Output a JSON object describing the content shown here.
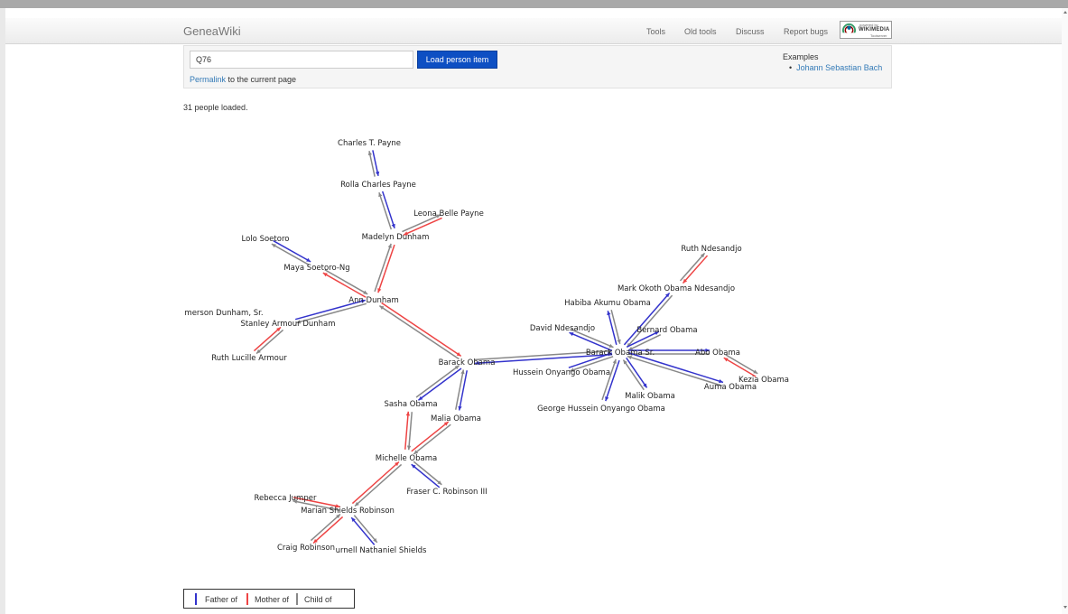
{
  "navbar": {
    "brand": "GeneaWiki",
    "links": [
      "Tools",
      "Old tools",
      "Discuss",
      "Report bugs"
    ],
    "badge": {
      "line1": "powered by",
      "line2": "WIKIMEDIA",
      "line3": "Toolserver"
    }
  },
  "search": {
    "value": "Q76",
    "button_label": "Load person item",
    "permalink_label": "Permalink",
    "permalink_suffix": " to the current page"
  },
  "examples": {
    "title": "Examples",
    "items": [
      "Johann Sebastian Bach"
    ]
  },
  "status": "31 people loaded.",
  "colors": {
    "father": "#3333cc",
    "mother": "#ee4444",
    "child": "#888888",
    "button": "#0d4fc3",
    "link": "#337ab7"
  },
  "graph": {
    "nodes": [
      {
        "id": "charles_payne",
        "label": "Charles T. Payne"
      },
      {
        "id": "rolla_payne",
        "label": "Rolla Charles Payne"
      },
      {
        "id": "leona_payne",
        "label": "Leona Belle Payne"
      },
      {
        "id": "madelyn_dunham",
        "label": "Madelyn Dunham"
      },
      {
        "id": "lolo_soetoro",
        "label": "Lolo Soetoro"
      },
      {
        "id": "maya_soetoro",
        "label": "Maya Soetoro-Ng"
      },
      {
        "id": "ann_dunham",
        "label": "Ann Dunham"
      },
      {
        "id": "emerson_dunham",
        "label": "merson Dunham, Sr."
      },
      {
        "id": "stanley_dunham",
        "label": "Stanley Armour Dunham"
      },
      {
        "id": "ruth_armour",
        "label": "Ruth Lucille Armour"
      },
      {
        "id": "barack_obama",
        "label": "Barack Obama"
      },
      {
        "id": "sasha_obama",
        "label": "Sasha Obama"
      },
      {
        "id": "malia_obama",
        "label": "Malia Obama"
      },
      {
        "id": "michelle_obama",
        "label": "Michelle Obama"
      },
      {
        "id": "fraser_robinson",
        "label": "Fraser C. Robinson III"
      },
      {
        "id": "rebecca_jumper",
        "label": "Rebecca Jumper"
      },
      {
        "id": "marian_robinson",
        "label": "Marian Shields Robinson"
      },
      {
        "id": "craig_robinson",
        "label": "Craig Robinson"
      },
      {
        "id": "purnell_shields",
        "label": "urnell Nathaniel Shields"
      },
      {
        "id": "ruth_ndesandjo",
        "label": "Ruth Ndesandjo"
      },
      {
        "id": "mark_ndesandjo",
        "label": "Mark Okoth Obama Ndesandjo"
      },
      {
        "id": "habiba_obama",
        "label": "Habiba Akumu Obama"
      },
      {
        "id": "bernard_obama",
        "label": "Bernard Obama"
      },
      {
        "id": "david_ndesandjo",
        "label": "David Ndesandjo"
      },
      {
        "id": "barack_sr",
        "label": "Barack Obama Sr."
      },
      {
        "id": "abo_obama",
        "label": "Abo Obama"
      },
      {
        "id": "hussein_onyango",
        "label": "Hussein Onyango Obama"
      },
      {
        "id": "kezia_obama",
        "label": "Kezia Obama"
      },
      {
        "id": "auma_obama",
        "label": "Auma Obama"
      },
      {
        "id": "malik_obama",
        "label": "Malik Obama"
      },
      {
        "id": "george_obama",
        "label": "George Hussein Onyango Obama"
      }
    ],
    "edges": [
      {
        "from": "rolla_payne",
        "to": "charles_payne",
        "rel": "father"
      },
      {
        "from": "madelyn_dunham",
        "to": "rolla_payne",
        "rel": "father"
      },
      {
        "from": "madelyn_dunham",
        "to": "leona_payne",
        "rel": "mother"
      },
      {
        "from": "ann_dunham",
        "to": "madelyn_dunham",
        "rel": "mother"
      },
      {
        "from": "maya_soetoro",
        "to": "lolo_soetoro",
        "rel": "father"
      },
      {
        "from": "maya_soetoro",
        "to": "ann_dunham",
        "rel": "mother"
      },
      {
        "from": "ann_dunham",
        "to": "stanley_dunham",
        "rel": "father"
      },
      {
        "from": "stanley_dunham",
        "to": "ruth_armour",
        "rel": "mother"
      },
      {
        "from": "barack_obama",
        "to": "ann_dunham",
        "rel": "mother"
      },
      {
        "from": "barack_obama",
        "to": "barack_sr",
        "rel": "father"
      },
      {
        "from": "sasha_obama",
        "to": "barack_obama",
        "rel": "father"
      },
      {
        "from": "malia_obama",
        "to": "barack_obama",
        "rel": "father"
      },
      {
        "from": "sasha_obama",
        "to": "michelle_obama",
        "rel": "mother"
      },
      {
        "from": "malia_obama",
        "to": "michelle_obama",
        "rel": "mother"
      },
      {
        "from": "michelle_obama",
        "to": "fraser_robinson",
        "rel": "father"
      },
      {
        "from": "michelle_obama",
        "to": "marian_robinson",
        "rel": "mother"
      },
      {
        "from": "marian_robinson",
        "to": "rebecca_jumper",
        "rel": "mother"
      },
      {
        "from": "craig_robinson",
        "to": "marian_robinson",
        "rel": "mother"
      },
      {
        "from": "marian_robinson",
        "to": "purnell_shields",
        "rel": "father"
      },
      {
        "from": "mark_ndesandjo",
        "to": "ruth_ndesandjo",
        "rel": "mother"
      },
      {
        "from": "mark_ndesandjo",
        "to": "barack_sr",
        "rel": "father"
      },
      {
        "from": "habiba_obama",
        "to": "barack_sr",
        "rel": "father"
      },
      {
        "from": "bernard_obama",
        "to": "barack_sr",
        "rel": "father"
      },
      {
        "from": "david_ndesandjo",
        "to": "barack_sr",
        "rel": "father"
      },
      {
        "from": "abo_obama",
        "to": "barack_sr",
        "rel": "father"
      },
      {
        "from": "barack_sr",
        "to": "hussein_onyango",
        "rel": "father"
      },
      {
        "from": "abo_obama",
        "to": "kezia_obama",
        "rel": "mother"
      },
      {
        "from": "auma_obama",
        "to": "barack_sr",
        "rel": "father"
      },
      {
        "from": "malik_obama",
        "to": "barack_sr",
        "rel": "father"
      },
      {
        "from": "george_obama",
        "to": "barack_sr",
        "rel": "father"
      }
    ]
  },
  "legend": {
    "items": [
      {
        "label": "Father of",
        "color": "#3333cc"
      },
      {
        "label": "Mother of",
        "color": "#ee4444"
      },
      {
        "label": "Child of",
        "color": "#888888"
      }
    ]
  }
}
